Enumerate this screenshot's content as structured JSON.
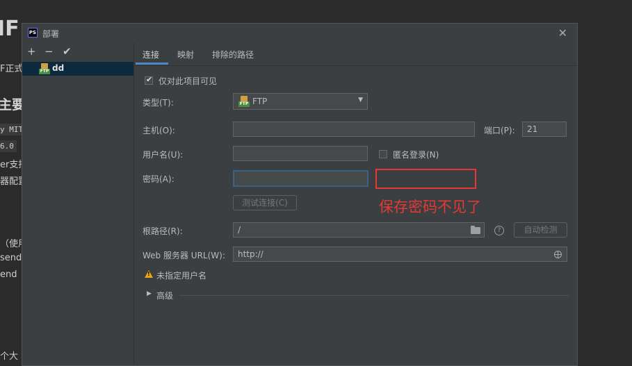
{
  "background": {
    "title_prefix": "IF",
    "title_faded": " ",
    "line1": "F正式",
    "heading": "主要",
    "code1": "y MIT",
    "code2": "6.0",
    "line2": "er支持",
    "line3": "器配置",
    "line4": "（使用",
    "line5": "send",
    "line6": "end",
    "line7": "个大"
  },
  "dialog": {
    "title": "部署",
    "app_icon_text": "PS",
    "close": "✕",
    "toolbar": {
      "add": "+",
      "remove": "−",
      "apply": "✔"
    },
    "server": {
      "name": "dd",
      "icon_badge": "FTP"
    },
    "tabs": [
      {
        "label": "连接"
      },
      {
        "label": "映射"
      },
      {
        "label": "排除的路径"
      }
    ],
    "connection": {
      "visible_only_label": "仅对此项目可见",
      "visible_only_checked": true,
      "type_label": "类型(T):",
      "type_value": "FTP",
      "host_label": "主机(O):",
      "host_value": "",
      "port_label": "端口(P):",
      "port_value": "21",
      "username_label": "用户名(U):",
      "username_value": "",
      "anonymous_label": "匿名登录(N)",
      "anonymous_checked": false,
      "password_label": "密码(A):",
      "password_value": "",
      "test_button": "测试连接(C)",
      "annotation": "保存密码不见了",
      "root_label": "根路径(R):",
      "root_value": "/",
      "help": "?",
      "autodetect_button": "自动检测",
      "web_url_label": "Web 服务器 URL(W):",
      "web_url_value": "http://",
      "warning_text": "未指定用户名",
      "warning_mark": "!",
      "advanced_label": "高级",
      "advanced_arrow": "▶"
    }
  },
  "colors": {
    "dialog_bg": "#3c3f41",
    "accent": "#4a88c7",
    "annotation_red": "#e53935",
    "warning": "#e6a817"
  }
}
